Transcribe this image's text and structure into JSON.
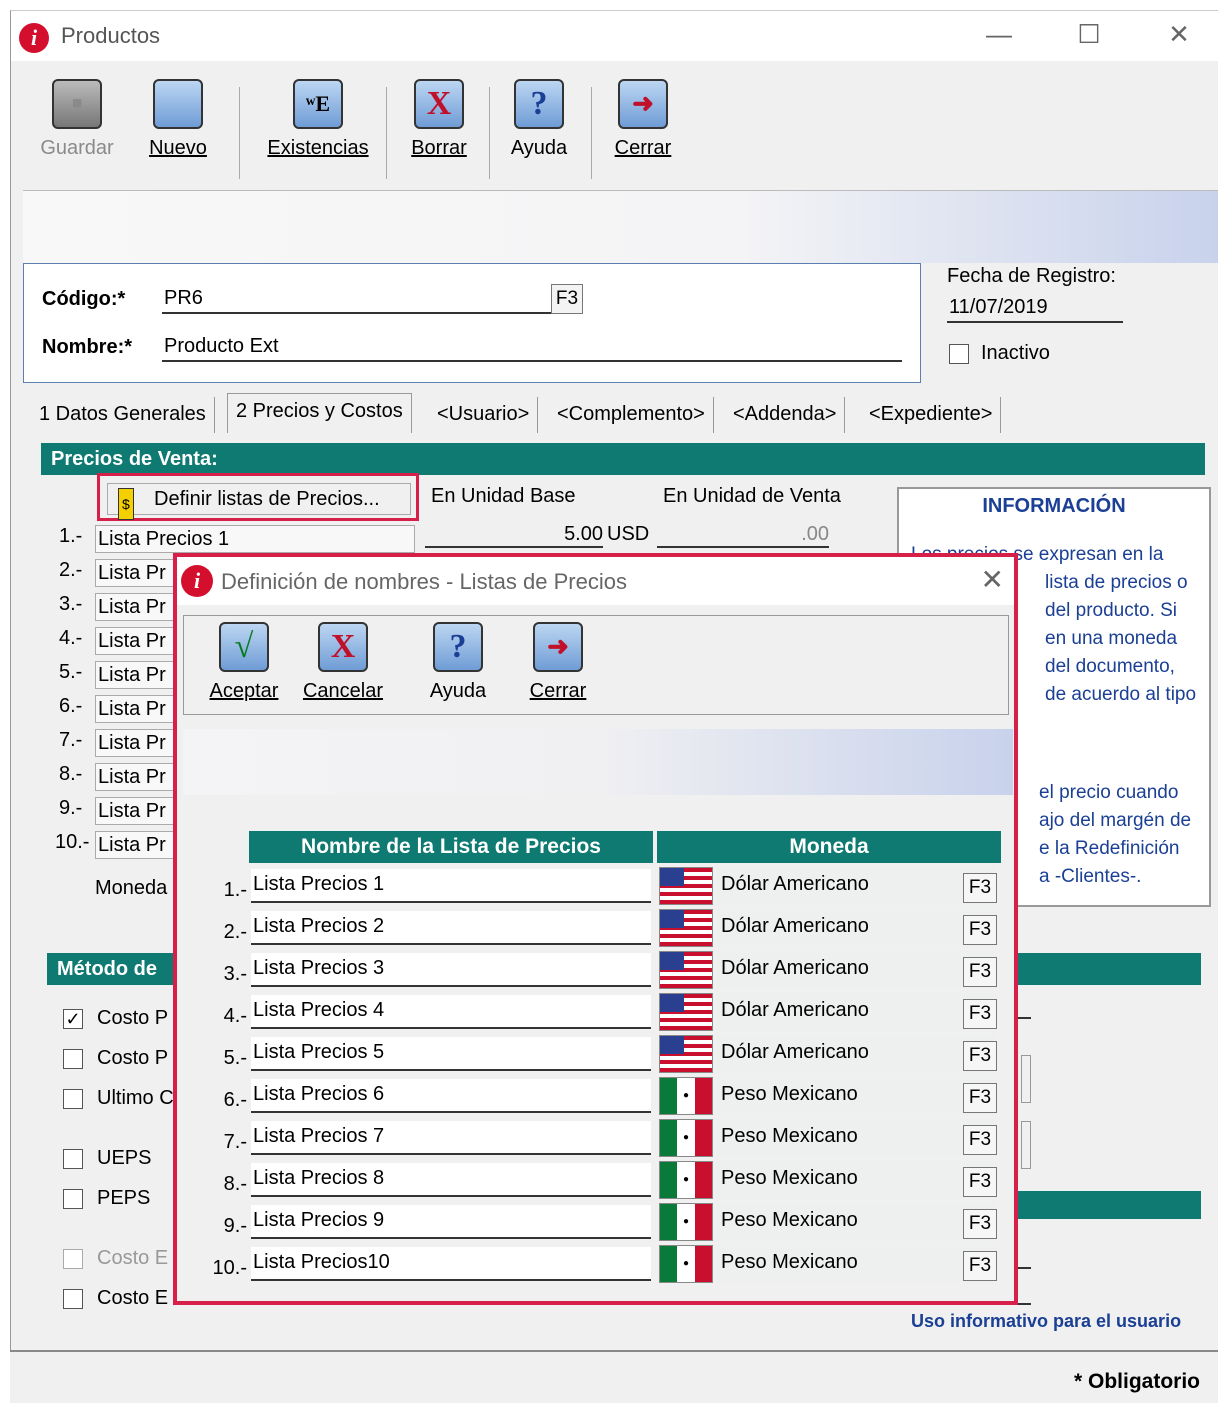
{
  "window": {
    "title": "Productos"
  },
  "toolbar": {
    "guardar": "Guardar",
    "nuevo": "Nuevo",
    "existencias": "Existencias",
    "borrar": "Borrar",
    "ayuda": "Ayuda",
    "cerrar": "Cerrar"
  },
  "form": {
    "codigo_label": "Código:*",
    "codigo_value": "PR6",
    "f3": "F3",
    "nombre_label": "Nombre:*",
    "nombre_value": "Producto Ext",
    "fecha_label": "Fecha de Registro:",
    "fecha_value": "11/07/2019",
    "inactivo_label": "Inactivo"
  },
  "tabs": [
    "1 Datos Generales",
    "2 Precios y Costos",
    "<Usuario>",
    "<Complemento>",
    "<Addenda>",
    "<Expediente>"
  ],
  "precios": {
    "header": "Precios de Venta:",
    "definir_button": "Definir listas de Precios...",
    "col_base": "En Unidad Base",
    "col_venta": "En Unidad de Venta",
    "row1_label": "1.-",
    "row1_name": "Lista Precios 1",
    "row1_base": "5.00",
    "row1_currency": "USD",
    "row1_venta": ".00",
    "rows": [
      "2.-",
      "3.-",
      "4.-",
      "5.-",
      "6.-",
      "7.-",
      "8.-",
      "9.-",
      "10.-"
    ],
    "row_partial": "Lista Pr",
    "moneda_label": "Moneda"
  },
  "info": {
    "title": "INFORMACIÓN",
    "text1": "Los precios se expresan en la",
    "text2": "lista de precios o",
    "text3": "del producto.  Si",
    "text4": "en una moneda",
    "text5": "del documento,",
    "text6": "de acuerdo al tipo",
    "text7": "el precio cuando",
    "text8": "ajo del margén de",
    "text9": "e la Redefinición",
    "text10": "a -Clientes-."
  },
  "metodo": {
    "header": "Método de",
    "costo_p1": "Costo P",
    "costo_p2": "Costo P",
    "ultimo": "Ultimo C",
    "ueps": "UEPS",
    "peps": "PEPS",
    "costo_e1": "Costo E",
    "costo_e2": "Costo E"
  },
  "footer": {
    "uso": "Uso informativo para el usuario",
    "obligatorio": "* Obligatorio"
  },
  "dialog": {
    "title": "Definición de nombres - Listas de Precios",
    "aceptar": "Aceptar",
    "cancelar": "Cancelar",
    "ayuda": "Ayuda",
    "cerrar": "Cerrar",
    "col_nombre": "Nombre de la Lista de Precios",
    "col_moneda": "Moneda",
    "f3": "F3",
    "rows": [
      {
        "num": "1.-",
        "name": "Lista Precios 1",
        "moneda": "Dólar Americano",
        "flag": "us"
      },
      {
        "num": "2.-",
        "name": "Lista Precios 2",
        "moneda": "Dólar Americano",
        "flag": "us"
      },
      {
        "num": "3.-",
        "name": "Lista Precios 3",
        "moneda": "Dólar Americano",
        "flag": "us"
      },
      {
        "num": "4.-",
        "name": "Lista Precios 4",
        "moneda": "Dólar Americano",
        "flag": "us"
      },
      {
        "num": "5.-",
        "name": "Lista Precios 5",
        "moneda": "Dólar Americano",
        "flag": "us"
      },
      {
        "num": "6.-",
        "name": "Lista Precios 6",
        "moneda": "Peso Mexicano",
        "flag": "mx"
      },
      {
        "num": "7.-",
        "name": "Lista Precios 7",
        "moneda": "Peso Mexicano",
        "flag": "mx"
      },
      {
        "num": "8.-",
        "name": "Lista Precios 8",
        "moneda": "Peso Mexicano",
        "flag": "mx"
      },
      {
        "num": "9.-",
        "name": "Lista Precios 9",
        "moneda": "Peso Mexicano",
        "flag": "mx"
      },
      {
        "num": "10.-",
        "name": "Lista Precios10",
        "moneda": "Peso Mexicano",
        "flag": "mx"
      }
    ]
  },
  "colors": {
    "accent_teal": "#0e7a72",
    "highlight_red": "#d6204a",
    "info_blue": "#1a3f94"
  }
}
